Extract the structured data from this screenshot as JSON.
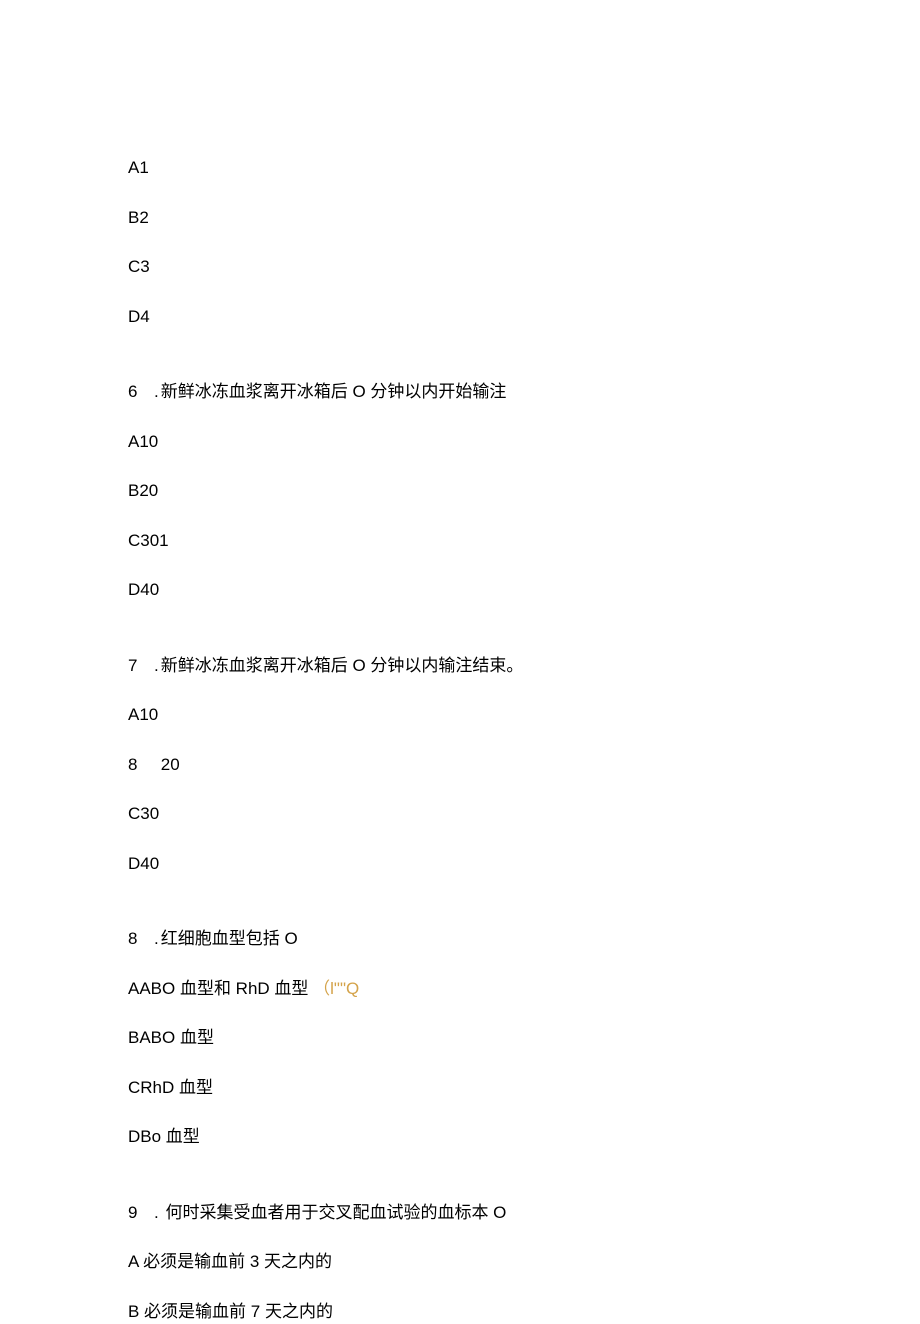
{
  "q5": {
    "optA": "A1",
    "optB": "B2",
    "optC": "C3",
    "optD": "D4"
  },
  "q6": {
    "num": "6",
    "dot": ".",
    "text": "新鲜冰冻血浆离开冰箱后 O 分钟以内开始输注",
    "optA": "A10",
    "optB": "B20",
    "optC": "C301",
    "optD": "D40"
  },
  "q7": {
    "num": "7",
    "dot": ".",
    "text": "新鲜冰冻血浆离开冰箱后 O 分钟以内输注结束。",
    "optA": "A10",
    "optB_num": "8",
    "optB_val": "20",
    "optC": "C30",
    "optD": "D40"
  },
  "q8": {
    "num": "8",
    "dot": ".",
    "text": "红细胞血型包括 O",
    "optA_main": "AABO 血型和 RhD 血型",
    "optA_gold": "（l\"\"Q",
    "optB": "BABO 血型",
    "optC": "CRhD 血型",
    "optD": "DBo 血型"
  },
  "q9": {
    "num": "9",
    "dot": ". ",
    "text": "何时采集受血者用于交叉配血试验的血标本 O",
    "optA": "A 必须是输血前 3 天之内的",
    "optB": "B 必须是输血前 7 天之内的"
  }
}
